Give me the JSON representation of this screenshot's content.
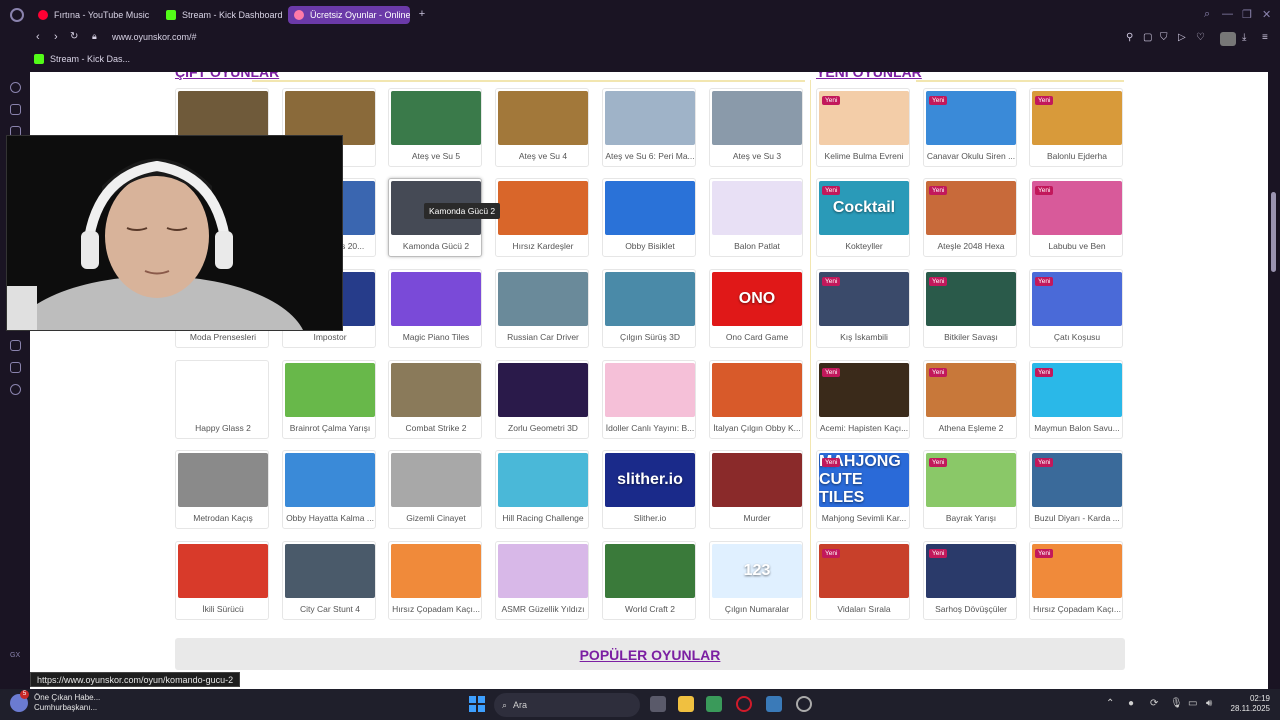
{
  "browser": {
    "tabs": [
      {
        "label": "Fırtına - YouTube Music",
        "favicon_color": "#ff0033",
        "active": false
      },
      {
        "label": "Stream - Kick Dashboard",
        "favicon_color": "#53fc18",
        "active": false
      },
      {
        "label": "Ücretsiz Oyunlar - Online",
        "favicon_color": "#ff7aa8",
        "active": true
      }
    ],
    "url": "www.oyunskor.com/#",
    "bookmarks": [
      {
        "label": "Stream - Kick Das..."
      }
    ]
  },
  "page": {
    "left_section_title": "ÇİFT OYUNLAR",
    "right_section_title": "YENİ OYUNLAR",
    "new_badge": "Yeni",
    "popular_title": "POPÜLER OYUNLAR",
    "tooltip": "Kamonda Gücü 2",
    "games_left": [
      [
        "",
        "",
        "Ateş ve Su 5",
        "Ateş ve Su 4",
        "Ateş ve Su 6: Peri Ma...",
        "Ateş ve Su 3"
      ],
      [
        "",
        "Impostor Ads 20...",
        "Kamonda Gücü 2",
        "Hırsız Kardeşler",
        "Obby Bisiklet",
        "Balon Patlat"
      ],
      [
        "Moda Prensesleri",
        "Impostor",
        "Magic Piano Tiles",
        "Russian Car Driver",
        "Çılgın Sürüş 3D",
        "Ono Card Game"
      ],
      [
        "Happy Glass 2",
        "Brainrot Çalma Yarışı",
        "Combat Strike 2",
        "Zorlu Geometri 3D",
        "İdoller Canlı Yayını: B...",
        "İtalyan Çılgın Obby K..."
      ],
      [
        "Metrodan Kaçış",
        "Obby Hayatta Kalma ...",
        "Gizemli Cinayet",
        "Hill Racing Challenge",
        "Slither.io",
        "Murder"
      ],
      [
        "İkili Sürücü",
        "City Car Stunt 4",
        "Hırsız Çopadam Kaçı...",
        "ASMR Güzellik Yıldızı",
        "World Craft 2",
        "Çılgın Numaralar"
      ]
    ],
    "games_right": [
      [
        "Kelime Bulma Evreni",
        "Canavar Okulu Siren ...",
        "Balonlu Ejderha"
      ],
      [
        "Kokteyller",
        "Ateşle 2048 Hexa",
        "Labubu ve Ben"
      ],
      [
        "Kış İskambili",
        "Bitkiler Savaşı",
        "Çatı Koşusu"
      ],
      [
        "Acemi: Hapisten Kaçı...",
        "Athena Eşleme 2",
        "Maymun Balon Savu..."
      ],
      [
        "Mahjong Sevimli Kar...",
        "Bayrak Yarışı",
        "Buzul Diyarı - Karda ..."
      ],
      [
        "Vidaları Sırala",
        "Sarhoş Dövüşçüler",
        "Hırsız Çopadam Kaçı..."
      ]
    ],
    "thumb_labels": {
      "ono": "ONO",
      "slither": "slither.io",
      "mahjong": "MAHJONG CUTE TILES",
      "cocktail": "Cocktail",
      "nums": "123"
    },
    "thumb_colors_left": [
      [
        "#6f5a3a",
        "#8a6a3a",
        "#3a7a4a",
        "#a2783a",
        "#9fb3c8",
        "#8a9aaa"
      ],
      [
        "#2a2a35",
        "#3a66b0",
        "#454a55",
        "#d9662a",
        "#2a72d8",
        "#e8e0f5"
      ],
      [
        "#b23b58",
        "#263c8a",
        "#7a4ad8",
        "#6a8a9a",
        "#4a8aa8",
        "#e01818"
      ],
      [
        "#ffffff",
        "#68b84a",
        "#8a7a5a",
        "#2a1a4a",
        "#f5c0d8",
        "#d85a2a"
      ],
      [
        "#8a8a8a",
        "#3a8ad8",
        "#a8a8a8",
        "#4ab8d8",
        "#1a2a8a",
        "#8a2a2a"
      ],
      [
        "#d83a2a",
        "#4a5a6a",
        "#f08a3a",
        "#d8b8e8",
        "#3a7a3a",
        "#e0f0ff"
      ]
    ],
    "thumb_colors_right": [
      [
        "#f3cda8",
        "#3a8ad8",
        "#d89a3a"
      ],
      [
        "#2a9ab8",
        "#c86a3a",
        "#d85a9a"
      ],
      [
        "#3a4a6a",
        "#2a5a4a",
        "#4a6ad8"
      ],
      [
        "#3a2a1a",
        "#c8783a",
        "#2ab8e8"
      ],
      [
        "#2a6ad8",
        "#8ac868",
        "#3a6a9a"
      ],
      [
        "#c8402a",
        "#2a3a6a",
        "#f08a3a"
      ]
    ],
    "status_url": "https://www.oyunskor.com/oyun/komando-gucu-2"
  },
  "taskbar": {
    "news_badge": "5",
    "news_line1": "Öne Çıkan Habe...",
    "news_line2": "Cumhurbaşkanı...",
    "search_label": "Ara",
    "time": "02:19",
    "date": "28.11.2025"
  }
}
